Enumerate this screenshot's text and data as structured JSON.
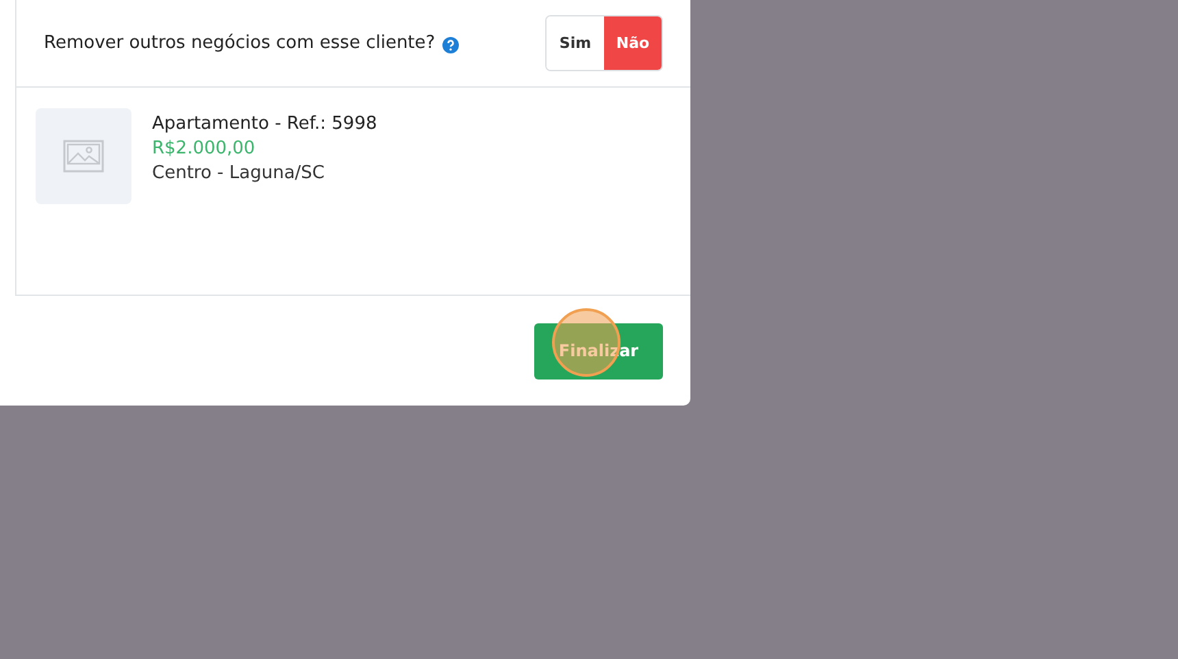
{
  "question": {
    "text": "Remover outros negócios com esse cliente?",
    "options": [
      {
        "label": "Sim",
        "selected": false
      },
      {
        "label": "Não",
        "selected": true
      }
    ]
  },
  "property": {
    "title": "Apartamento - Ref.: 5998",
    "price": "R$2.000,00",
    "location": "Centro - Laguna/SC"
  },
  "footer": {
    "button": "Finalizar"
  }
}
